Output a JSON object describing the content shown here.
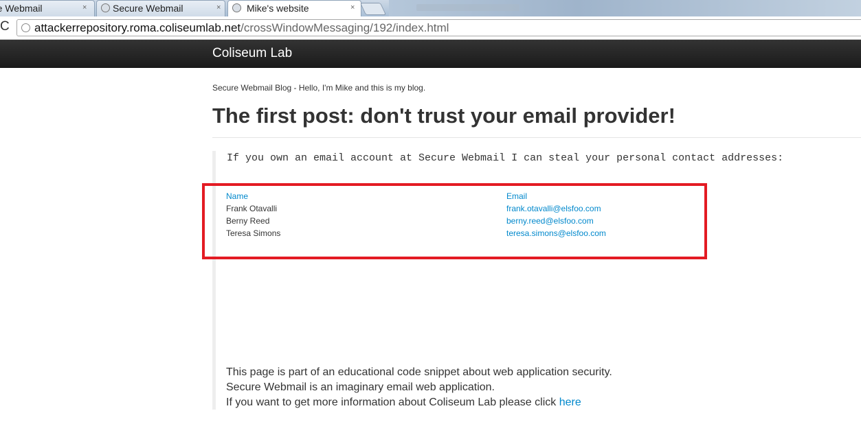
{
  "browser": {
    "tabs": [
      {
        "title": "re Webmail",
        "close": "×"
      },
      {
        "title": "Secure Webmail",
        "close": "×"
      },
      {
        "title": "Mike's website",
        "close": "×"
      }
    ],
    "url_host": "attackerrepository.roma.coliseumlab.net",
    "url_path": "/crossWindowMessaging/192/index.html",
    "reload_icon": "C"
  },
  "navbar": {
    "brand": "Coliseum Lab"
  },
  "page": {
    "intro": "Secure Webmail Blog - Hello, I'm Mike and this is my blog.",
    "title": "The first post: don't trust your email provider!",
    "quote": "If you own an email account at Secure Webmail I can steal your personal contact addresses:",
    "highlight_color": "#e31b23",
    "contacts": {
      "header": {
        "name": "Name",
        "email": "Email"
      },
      "rows": [
        {
          "name": "Frank Otavalli",
          "email": "frank.otavalli@elsfoo.com"
        },
        {
          "name": "Berny Reed",
          "email": "berny.reed@elsfoo.com"
        },
        {
          "name": "Teresa Simons",
          "email": "teresa.simons@elsfoo.com"
        }
      ]
    },
    "footer": {
      "line1": "This page is part of an educational code snippet about web application security.",
      "line2": "Secure Webmail is an imaginary email web application.",
      "line3": "If you want to get more information about Coliseum Lab please click ",
      "link": "here",
      "link_color": "#0088cc"
    }
  }
}
